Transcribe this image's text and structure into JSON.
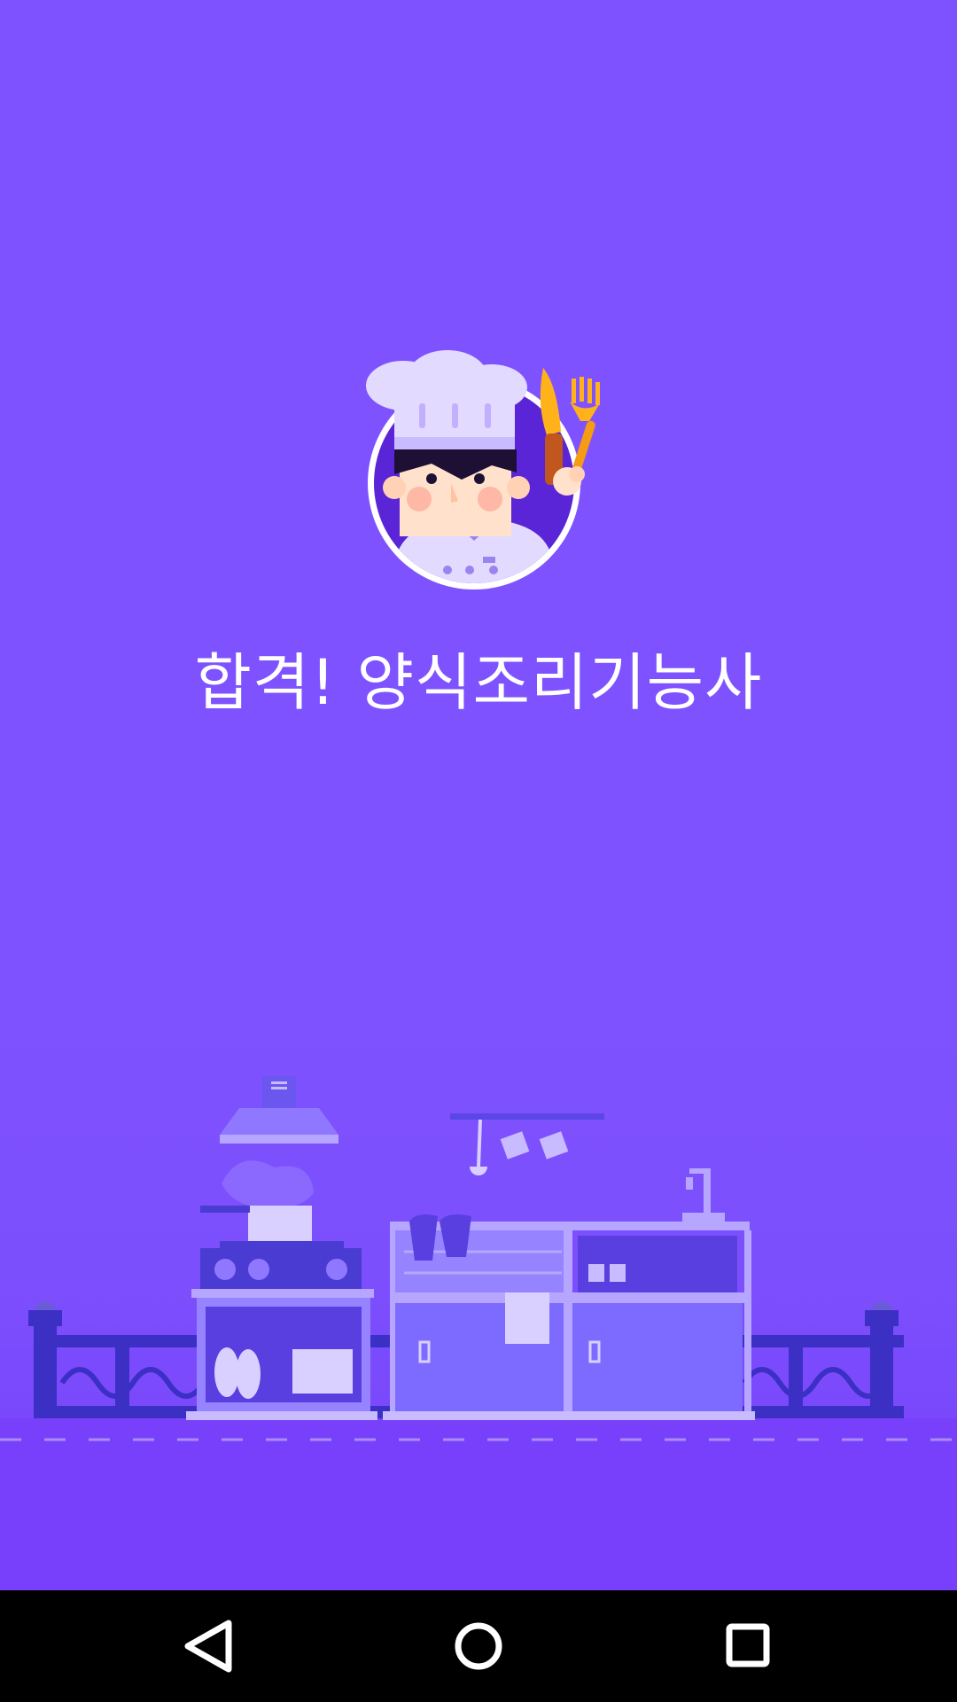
{
  "app": {
    "title": "합격! 양식조리기능사"
  },
  "logo": {
    "icon": "chef-mascot-icon"
  },
  "illustration": {
    "icon": "kitchen-illustration"
  },
  "navbar": {
    "back_icon": "back-triangle-icon",
    "home_icon": "home-circle-icon",
    "recents_icon": "recents-square-icon"
  },
  "colors": {
    "background": "#7f52ff",
    "title_text": "#ffffff",
    "navbar": "#000000"
  }
}
